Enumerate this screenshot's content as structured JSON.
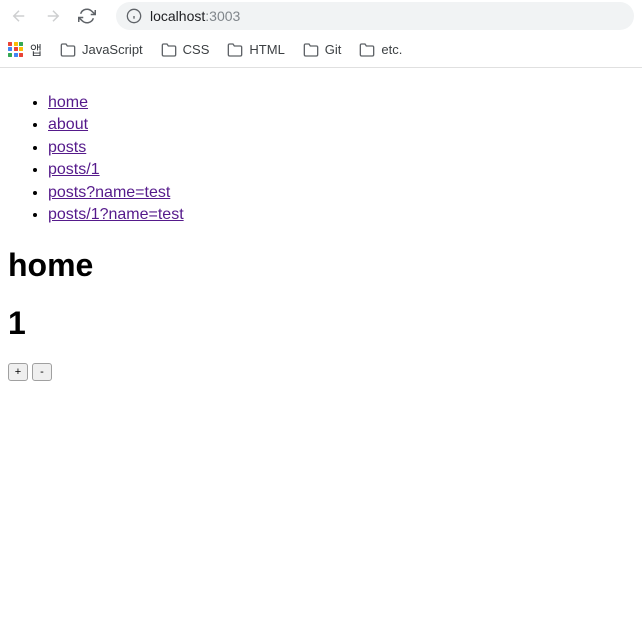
{
  "browser": {
    "url": {
      "host": "localhost",
      "port": ":3003"
    }
  },
  "bookmarks": {
    "apps": "앱",
    "items": [
      {
        "label": "JavaScript"
      },
      {
        "label": "CSS"
      },
      {
        "label": "HTML"
      },
      {
        "label": "Git"
      },
      {
        "label": "etc."
      }
    ]
  },
  "nav_links": [
    {
      "text": "home"
    },
    {
      "text": "about"
    },
    {
      "text": "posts"
    },
    {
      "text": "posts/1"
    },
    {
      "text": "posts?name=test"
    },
    {
      "text": "posts/1?name=test"
    }
  ],
  "page": {
    "title": "home",
    "counter_value": "1"
  },
  "buttons": {
    "increment": "+",
    "decrement": "-"
  }
}
